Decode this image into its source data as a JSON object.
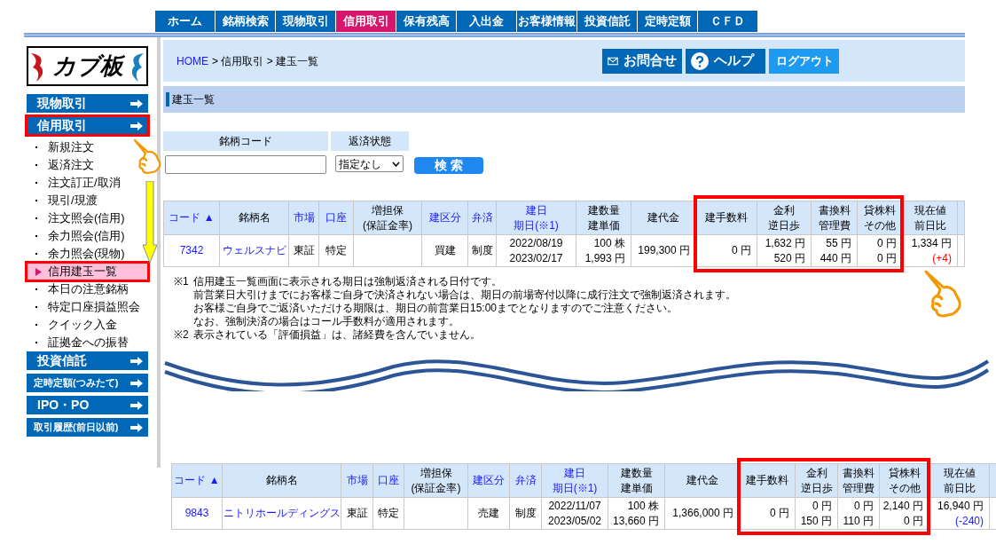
{
  "nav": [
    {
      "label": "ホーム",
      "selected": false
    },
    {
      "label": "銘柄検索",
      "selected": false
    },
    {
      "label": "現物取引",
      "selected": false
    },
    {
      "label": "信用取引",
      "selected": true
    },
    {
      "label": "保有残高",
      "selected": false
    },
    {
      "label": "入出金",
      "selected": false
    },
    {
      "label": "お客様情報",
      "selected": false
    },
    {
      "label": "投資信託",
      "selected": false
    },
    {
      "label": "定時定額",
      "selected": false
    },
    {
      "label": "ＣＦＤ",
      "selected": false
    }
  ],
  "logo": {
    "text": "カブ板"
  },
  "sidebar": [
    {
      "kind": "section",
      "label": "現物取引",
      "outlined": false
    },
    {
      "kind": "section",
      "label": "信用取引",
      "outlined": true
    },
    {
      "kind": "sub",
      "label": "新規注文",
      "selected": false,
      "outlined": false
    },
    {
      "kind": "sub",
      "label": "返済注文",
      "selected": false,
      "outlined": false
    },
    {
      "kind": "sub",
      "label": "注文訂正/取消",
      "selected": false,
      "outlined": false
    },
    {
      "kind": "sub",
      "label": "現引/現渡",
      "selected": false,
      "outlined": false
    },
    {
      "kind": "sub",
      "label": "注文照会(信用)",
      "selected": false,
      "outlined": false
    },
    {
      "kind": "sub",
      "label": "余力照会(信用)",
      "selected": false,
      "outlined": false
    },
    {
      "kind": "sub",
      "label": "余力照会(現物)",
      "selected": false,
      "outlined": false
    },
    {
      "kind": "sub",
      "label": "信用建玉一覧",
      "selected": true,
      "outlined": true
    },
    {
      "kind": "sub",
      "label": "本日の注意銘柄",
      "selected": false,
      "outlined": false
    },
    {
      "kind": "sub",
      "label": "特定口座損益照会",
      "selected": false,
      "outlined": false
    },
    {
      "kind": "sub",
      "label": "クイック入金",
      "selected": false,
      "outlined": false
    },
    {
      "kind": "sub",
      "label": "証拠金への振替",
      "selected": false,
      "outlined": false
    },
    {
      "kind": "section",
      "label": "投資信託",
      "outlined": false
    },
    {
      "kind": "small-section",
      "label": "定時定額(つみたて)",
      "outlined": false
    },
    {
      "kind": "section",
      "label": "IPO・PO",
      "outlined": false
    },
    {
      "kind": "small-section",
      "label": "取引履歴(前日以前)",
      "outlined": false
    }
  ],
  "breadcrumb": {
    "home": "HOME",
    "path": "> 信用取引 > 建玉一覧"
  },
  "header_buttons": [
    {
      "kind": "mail",
      "label": "お問合せ"
    },
    {
      "kind": "help",
      "label": "ヘルプ"
    },
    {
      "kind": "logout",
      "label": "ログアウト"
    }
  ],
  "section_title": "建玉一覧",
  "search": {
    "code_label": "銘柄コード",
    "status_label": "返済状態",
    "status_value": "指定なし",
    "button": "検 索"
  },
  "tables": [
    {
      "columns": [
        {
          "label": [
            "コード ▲"
          ],
          "link": true,
          "outlined": false
        },
        {
          "label": [
            "銘柄名"
          ],
          "link": false,
          "outlined": false
        },
        {
          "label": [
            "市場"
          ],
          "link": true,
          "outlined": false
        },
        {
          "label": [
            "口座"
          ],
          "link": true,
          "outlined": false
        },
        {
          "label": [
            "増担保",
            "(保証金率)"
          ],
          "link": false,
          "outlined": false
        },
        {
          "label": [
            "建区分"
          ],
          "link": true,
          "outlined": false
        },
        {
          "label": [
            "弁済"
          ],
          "link": true,
          "outlined": false
        },
        {
          "label": [
            "建日",
            "期日(※1)"
          ],
          "link": true,
          "outlined": false
        },
        {
          "label": [
            "建数量",
            "建単価"
          ],
          "link": false,
          "outlined": false
        },
        {
          "label": [
            "建代金"
          ],
          "link": false,
          "outlined": false
        },
        {
          "label": [
            "建手数料"
          ],
          "link": false,
          "outlined": true
        },
        {
          "label": [
            "金利",
            "逆日歩"
          ],
          "link": false,
          "outlined": true
        },
        {
          "label": [
            "書換料",
            "管理費"
          ],
          "link": false,
          "outlined": true
        },
        {
          "label": [
            "貸株料",
            "その他"
          ],
          "link": false,
          "outlined": true
        },
        {
          "label": [
            "現在値",
            "前日比"
          ],
          "link": false,
          "outlined": false
        }
      ],
      "rows": [
        {
          "code": "7342",
          "name": "ウェルスナビ",
          "market": "東証",
          "account": "特定",
          "build_type": "買建",
          "settlement": "制度",
          "dates": [
            "2022/08/19",
            "2023/02/17"
          ],
          "qty_price": [
            "100 株",
            "1,993 円"
          ],
          "amount": "199,300 円",
          "fee": "0 円",
          "interest": [
            "1,632 円",
            "520 円"
          ],
          "rewrite": [
            "55 円",
            "440 円"
          ],
          "lending": [
            "0 円",
            "0 円"
          ],
          "price": "1,334 円",
          "change": {
            "text": "(+4)",
            "color": "#ff0000"
          }
        }
      ]
    },
    {
      "columns": [
        {
          "label": [
            "コード ▲"
          ],
          "link": true,
          "outlined": false
        },
        {
          "label": [
            "銘柄名"
          ],
          "link": false,
          "outlined": false
        },
        {
          "label": [
            "市場"
          ],
          "link": true,
          "outlined": false
        },
        {
          "label": [
            "口座"
          ],
          "link": true,
          "outlined": false
        },
        {
          "label": [
            "増担保",
            "(保証金率)"
          ],
          "link": false,
          "outlined": false
        },
        {
          "label": [
            "建区分"
          ],
          "link": true,
          "outlined": false
        },
        {
          "label": [
            "弁済"
          ],
          "link": true,
          "outlined": false
        },
        {
          "label": [
            "建日",
            "期日(※1)"
          ],
          "link": true,
          "outlined": false
        },
        {
          "label": [
            "建数量",
            "建単価"
          ],
          "link": false,
          "outlined": false
        },
        {
          "label": [
            "建代金"
          ],
          "link": false,
          "outlined": false
        },
        {
          "label": [
            "建手数料"
          ],
          "link": false,
          "outlined": true
        },
        {
          "label": [
            "金利",
            "逆日歩"
          ],
          "link": false,
          "outlined": true
        },
        {
          "label": [
            "書換料",
            "管理費"
          ],
          "link": false,
          "outlined": true
        },
        {
          "label": [
            "貸株料",
            "その他"
          ],
          "link": false,
          "outlined": true
        },
        {
          "label": [
            "現在値",
            "前日比"
          ],
          "link": false,
          "outlined": false
        }
      ],
      "rows": [
        {
          "code": "9843",
          "name": "ニトリホールディングス",
          "market": "東証",
          "account": "特定",
          "build_type": "売建",
          "settlement": "制度",
          "dates": [
            "2022/11/07",
            "2023/05/02"
          ],
          "qty_price": [
            "100 株",
            "13,660 円"
          ],
          "amount": "1,366,000 円",
          "fee": "0 円",
          "interest": [
            "0 円",
            "150 円"
          ],
          "rewrite": [
            "0 円",
            "110 円"
          ],
          "lending": [
            "2,140 円",
            "0 円"
          ],
          "price": "16,940 円",
          "change": {
            "text": "(-240)",
            "color": "#1a1aff"
          }
        }
      ]
    }
  ],
  "notes": [
    {
      "mark": "※1",
      "lines": [
        "信用建玉一覧画面に表示される期日は強制返済される日付です。",
        "前営業日大引けまでにお客様ご自身で決済されない場合は、期日の前場寄付以降に成行注文で強制返済されます。",
        "お客様ご自身でご返済いただける期限は、期日の前営業日15:00までとなりますのでご注意ください。",
        "なお、強制決済の場合はコール手数料が適用されます。"
      ]
    },
    {
      "mark": "※2",
      "lines": [
        "表示されている「評価損益」は、諸経費を含んでいません。"
      ]
    }
  ]
}
